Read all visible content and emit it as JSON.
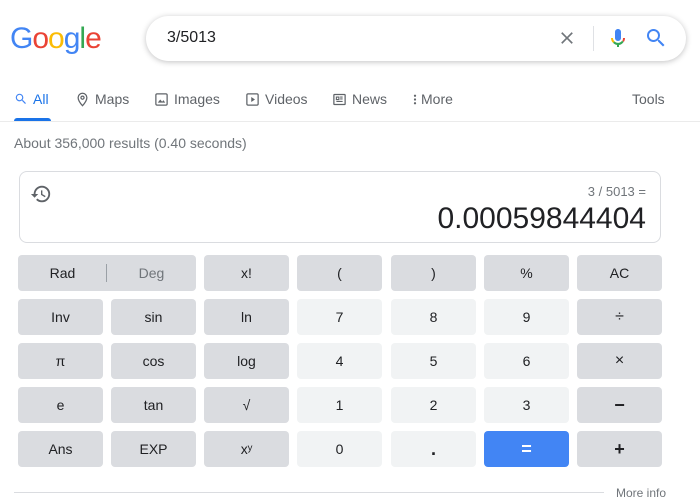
{
  "logo": {
    "letters": [
      "G",
      "o",
      "o",
      "g",
      "l",
      "e"
    ],
    "colors": [
      "#4285f4",
      "#ea4335",
      "#fbbc05",
      "#4285f4",
      "#34a853",
      "#ea4335"
    ]
  },
  "search": {
    "query": "3/5013",
    "clear_icon": "close-icon",
    "mic_icon": "microphone-icon",
    "search_icon": "search-icon"
  },
  "tabs": [
    {
      "label": "All",
      "icon": "search-icon",
      "active": true
    },
    {
      "label": "Maps",
      "icon": "map-pin-icon"
    },
    {
      "label": "Images",
      "icon": "image-icon"
    },
    {
      "label": "Videos",
      "icon": "play-icon"
    },
    {
      "label": "News",
      "icon": "newspaper-icon"
    },
    {
      "label": "More",
      "icon": "kebab-icon"
    }
  ],
  "tools_label": "Tools",
  "result_stats": "About 356,000 results (0.40 seconds)",
  "calculator": {
    "expression": "3 / 5013 =",
    "result": "0.00059844404",
    "mode": {
      "rad": "Rad",
      "deg": "Deg",
      "active": "Rad"
    },
    "rows": [
      [
        "x!",
        "(",
        ")",
        "%",
        "AC"
      ],
      [
        "Inv",
        "sin",
        "ln",
        "7",
        "8",
        "9",
        "÷"
      ],
      [
        "π",
        "cos",
        "log",
        "4",
        "5",
        "6",
        "×"
      ],
      [
        "e",
        "tan",
        "√",
        "1",
        "2",
        "3",
        "−"
      ],
      [
        "Ans",
        "EXP",
        "xʸ",
        "0",
        ".",
        "=",
        "+"
      ]
    ],
    "accent": "#4285f4"
  },
  "more_info": "More info"
}
